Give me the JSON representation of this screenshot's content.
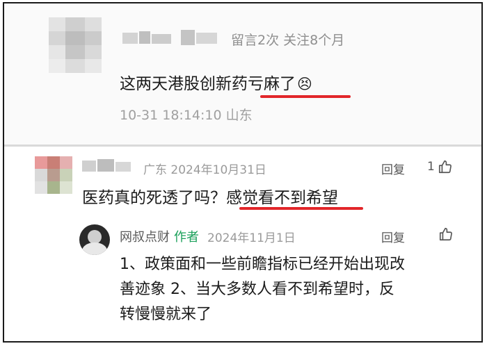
{
  "comment1": {
    "meta": "留言2次 关注8个月",
    "text": "这两天港股创新药亏麻了",
    "emoji": "😣",
    "time_location": "10-31 18:14:10 山东"
  },
  "comment2": {
    "location_date": "广东 2024年10月31日",
    "reply_label": "回复",
    "like_count": "1",
    "text_prefix": "医药真的死透了吗？",
    "text_highlight": "感觉看不到希望"
  },
  "reply": {
    "author": "网叔点财",
    "author_tag": "作者",
    "date": "2024年11月1日",
    "reply_label": "回复",
    "lines": [
      "1、政策面和一些前瞻指标已经开始出现改",
      "善迹象 2、当大多数人看不到希望时，反",
      "转慢慢就来了"
    ]
  },
  "colors": {
    "highlight_red": "#e2262a",
    "author_tag_green": "#1aa05a",
    "meta_gray": "#9a9a9a"
  }
}
